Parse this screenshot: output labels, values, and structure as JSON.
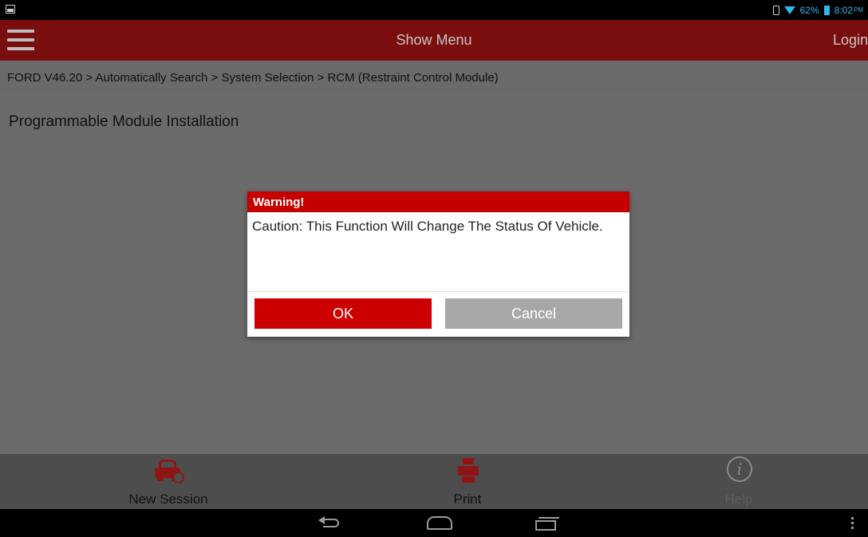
{
  "status_bar": {
    "battery": "62%",
    "time": "8:02",
    "ampm": "PM"
  },
  "app_bar": {
    "title": "Show Menu",
    "login_label": "Login"
  },
  "breadcrumb": "FORD V46.20 > Automatically Search > System Selection > RCM (Restraint Control Module)",
  "page_title": "Programmable Module Installation",
  "dialog": {
    "title": "Warning!",
    "message": "Caution: This Function Will Change The Status Of Vehicle.",
    "ok_label": "OK",
    "cancel_label": "Cancel"
  },
  "toolbar": {
    "new_session_label": "New Session",
    "print_label": "Print",
    "help_label": "Help"
  },
  "icons": {
    "menu": "hamburger-icon",
    "new_session": "car-check-icon",
    "print": "printer-icon",
    "help": "info-icon"
  },
  "colors": {
    "app_bar": "#7a0e0e",
    "dialog_header": "#c40000",
    "ok_button": "#cc0000",
    "cancel_button": "#a8a8a8",
    "status_accent": "#33b5e5"
  }
}
